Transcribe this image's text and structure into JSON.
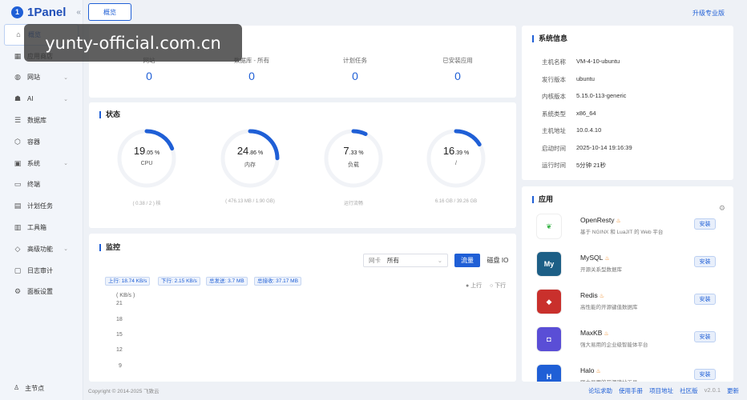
{
  "app": {
    "logo_mark": "1",
    "name": "1Panel",
    "collapse_icon": "«"
  },
  "sidebar": {
    "items": [
      {
        "label": "概览",
        "icon": "home-icon",
        "glyph": "⌂"
      },
      {
        "label": "应用商店",
        "icon": "apps-icon",
        "glyph": "▦"
      },
      {
        "label": "网站",
        "icon": "globe-icon",
        "glyph": "◍",
        "arrow": "⌄"
      },
      {
        "label": "AI",
        "icon": "robot-icon",
        "glyph": "☗",
        "arrow": "⌄"
      },
      {
        "label": "数据库",
        "icon": "database-icon",
        "glyph": "☰"
      },
      {
        "label": "容器",
        "icon": "container-icon",
        "glyph": "⬡"
      },
      {
        "label": "系统",
        "icon": "system-icon",
        "glyph": "▣",
        "arrow": "⌄"
      },
      {
        "label": "终端",
        "icon": "terminal-icon",
        "glyph": "▭"
      },
      {
        "label": "计划任务",
        "icon": "cron-icon",
        "glyph": "▤"
      },
      {
        "label": "工具箱",
        "icon": "toolbox-icon",
        "glyph": "▥"
      },
      {
        "label": "高级功能",
        "icon": "diamond-icon",
        "glyph": "◇",
        "arrow": "⌄"
      },
      {
        "label": "日志审计",
        "icon": "log-icon",
        "glyph": "▢"
      },
      {
        "label": "面板设置",
        "icon": "settings-icon",
        "glyph": "⚙"
      }
    ],
    "footer": {
      "label": "主节点",
      "glyph": "♙"
    }
  },
  "topbar": {
    "tab": "概览",
    "upgrade": "升级专业版"
  },
  "overview": {
    "items": [
      {
        "label": "网站",
        "value": "0"
      },
      {
        "label": "数据库 - 所有",
        "value": "0"
      },
      {
        "label": "计划任务",
        "value": "0"
      },
      {
        "label": "已安装应用",
        "value": "0"
      }
    ]
  },
  "status": {
    "title": "状态",
    "gauges": [
      {
        "int": "19",
        "dec": ".05",
        "unit": " %",
        "label": "CPU",
        "foot": "( 0.38 / 2 ) 核",
        "percent": 19.05
      },
      {
        "int": "24",
        "dec": ".86",
        "unit": " %",
        "label": "内存",
        "foot": "( 476.13 MB / 1.90 GB)",
        "percent": 24.86
      },
      {
        "int": "7",
        "dec": ".33",
        "unit": " %",
        "label": "负载",
        "foot": "运行流畅",
        "percent": 7.33
      },
      {
        "int": "16",
        "dec": ".39",
        "unit": " %",
        "label": "/",
        "foot": "6.16 GB / 39.26 GB",
        "percent": 16.39
      }
    ]
  },
  "monitor": {
    "title": "监控",
    "nic_label": "网卡",
    "nic_value": "所有",
    "tab_traffic": "流量",
    "tab_disk": "磁盘 IO",
    "tags": [
      "上行: 18.74 KB/s",
      "下行: 2.15 KB/s",
      "总发送: 3.7 MB",
      "总接收: 37.17 MB"
    ],
    "legend_up": "● 上行",
    "legend_down": "○ 下行",
    "y_unit": "( KB/s )",
    "y_ticks": [
      "21",
      "18",
      "15",
      "12",
      "9"
    ]
  },
  "system_info": {
    "title": "系统信息",
    "rows": [
      {
        "k": "主机名称",
        "v": "VM-4-10-ubuntu"
      },
      {
        "k": "发行版本",
        "v": "ubuntu"
      },
      {
        "k": "内核版本",
        "v": "5.15.0-113-generic"
      },
      {
        "k": "系统类型",
        "v": "x86_64"
      },
      {
        "k": "主机地址",
        "v": "10.0.4.10"
      },
      {
        "k": "启动时间",
        "v": "2025-10-14 19:16:39"
      },
      {
        "k": "运行时间",
        "v": "5分钟 21秒"
      }
    ]
  },
  "apps": {
    "title": "应用",
    "settings_glyph": "⚙",
    "items": [
      {
        "name": "OpenResty",
        "desc": "基于 NGINX 和 LuaJIT 的 Web 平台",
        "install": "安装",
        "color": "#ffffff",
        "glyph": "❦",
        "glyph_color": "#3bb54a"
      },
      {
        "name": "MySQL",
        "desc": "开源关系型数据库",
        "install": "安装",
        "color": "#1d5f86",
        "glyph": "My",
        "glyph_color": "#ffffff"
      },
      {
        "name": "Redis",
        "desc": "高性能的开源键值数据库",
        "install": "安装",
        "color": "#c9302c",
        "glyph": "◆",
        "glyph_color": "#ffffff"
      },
      {
        "name": "MaxKB",
        "desc": "强大易用的企业级智能体平台",
        "install": "安装",
        "color": "#5a4ed6",
        "glyph": "◘",
        "glyph_color": "#ffffff"
      },
      {
        "name": "Halo",
        "desc": "强大易用的开源建站工具",
        "install": "安装",
        "color": "#1f5fd6",
        "glyph": "H",
        "glyph_color": "#ffffff"
      }
    ],
    "fire": "♨"
  },
  "footer": {
    "copyright": "Copyright © 2014-2025 飞致云",
    "links": [
      "论坛求助",
      "使用手册",
      "项目地址",
      "社区版"
    ],
    "version": "v2.0.1",
    "update": "更新"
  },
  "watermark": "yunty-official.com.cn",
  "colors": {
    "primary": "#1f5fd6",
    "background": "#eef1f6"
  }
}
